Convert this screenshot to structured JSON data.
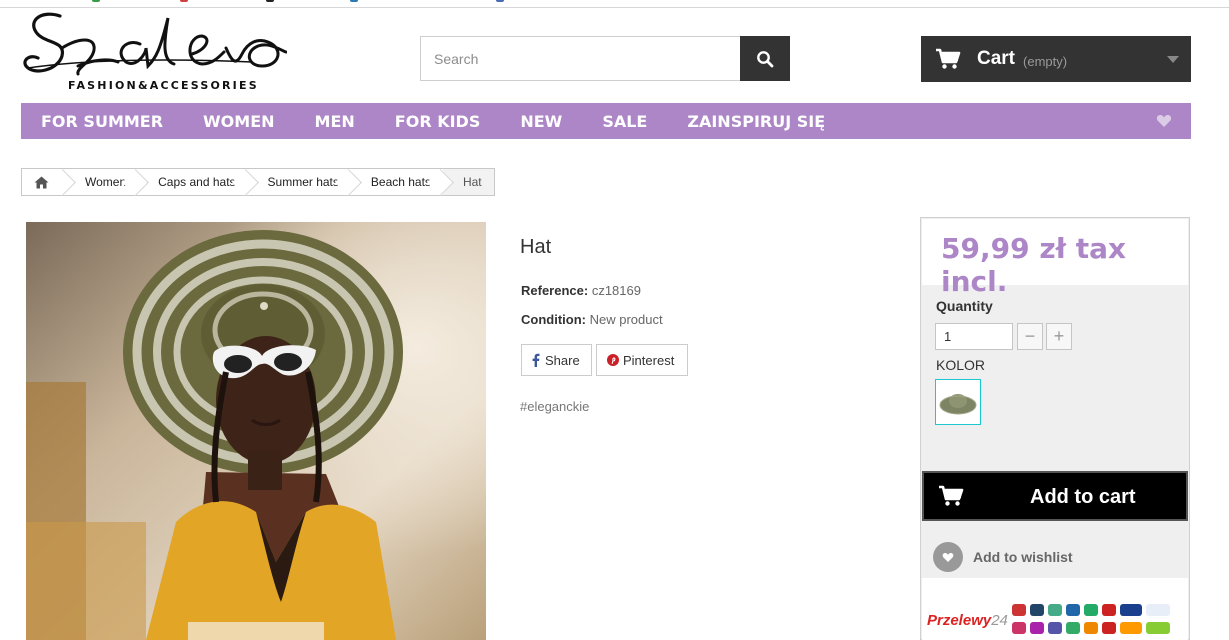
{
  "header": {
    "logo_text": "Szalew",
    "logo_tagline": "FASHION&ACCESSORIES",
    "search_placeholder": "Search",
    "cart_label": "Cart",
    "cart_status": "(empty)"
  },
  "nav": {
    "items": [
      "FOR SUMMER",
      "WOMEN",
      "MEN",
      "FOR KIDS",
      "NEW",
      "SALE",
      "ZAINSPIRUJ SIĘ"
    ]
  },
  "breadcrumb": [
    "Women",
    "Caps and hats",
    "Summer hats",
    "Beach hats",
    "Hat"
  ],
  "product": {
    "title": "Hat",
    "reference_label": "Reference:",
    "reference_value": "cz18169",
    "condition_label": "Condition:",
    "condition_value": "New product",
    "share_label": "Share",
    "pinterest_label": "Pinterest",
    "tag": "#eleganckie"
  },
  "buybox": {
    "price": "59,99 zł tax incl.",
    "quantity_label": "Quantity",
    "quantity_value": "1",
    "color_label": "KOLOR",
    "add_to_cart": "Add to cart",
    "wishlist": "Add to wishlist",
    "payment_brand": "Przelewy",
    "payment_brand_suffix": "24"
  },
  "colors": {
    "accent": "#ac86c6",
    "dark": "#333333",
    "cta": "#000000"
  },
  "icons": [
    "search-icon",
    "cart-icon",
    "heart-icon",
    "home-icon",
    "facebook-icon",
    "pinterest-icon"
  ]
}
